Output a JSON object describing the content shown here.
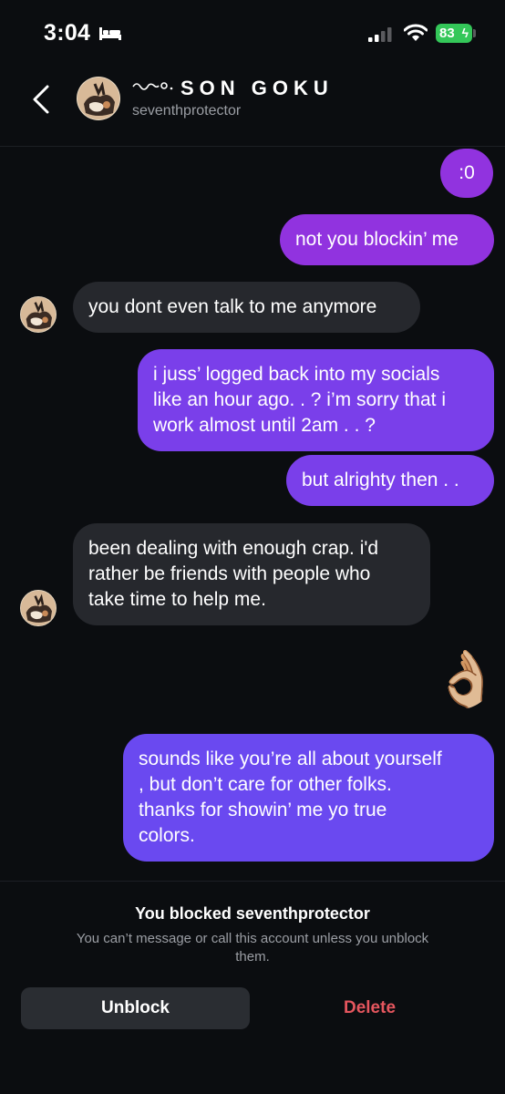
{
  "status_bar": {
    "time": "3:04",
    "battery": "83",
    "icons": [
      "bed-icon",
      "cellular-signal-icon",
      "wifi-icon",
      "battery-icon"
    ]
  },
  "header": {
    "display_name": "SON GOKU",
    "username": "seventhprotector",
    "icons": [
      "back-chevron-icon",
      "profile-avatar",
      "decorative-swirl-icon"
    ]
  },
  "messages": [
    {
      "side": "outgoing",
      "text": ":0"
    },
    {
      "side": "outgoing",
      "text": "not you blockin’ me"
    },
    {
      "side": "incoming",
      "text": "you dont even talk to me anymore"
    },
    {
      "side": "outgoing",
      "lines": [
        "i juss’ logged back into my socials",
        "like an hour ago. . ? i’m sorry that i",
        "work almost until 2am . . ?"
      ]
    },
    {
      "side": "outgoing",
      "text": "but alrighty then . ."
    },
    {
      "side": "incoming",
      "lines": [
        "been dealing with enough crap. i'd",
        "rather be friends with people who",
        "take time to help me."
      ]
    },
    {
      "side": "outgoing",
      "emoji": "👌🏼"
    },
    {
      "side": "outgoing",
      "lines": [
        "sounds like you’re all about yourself",
        ", but don’t care for other folks.",
        "thanks for showin’ me yo true",
        "colors."
      ]
    }
  ],
  "footer": {
    "blocked_title": "You blocked seventhprotector",
    "blocked_desc_lines": [
      "You can’t message or call this account unless you unblock",
      "them."
    ],
    "unblock_label": "Unblock",
    "delete_label": "Delete"
  },
  "colors": {
    "background": "#0b0d10",
    "outgoing_bubble_top": "#9133df",
    "outgoing_bubble_bottom": "#6a49f0",
    "incoming_bubble": "#26282d",
    "delete_red": "#e5565e",
    "battery_green": "#34c759"
  }
}
